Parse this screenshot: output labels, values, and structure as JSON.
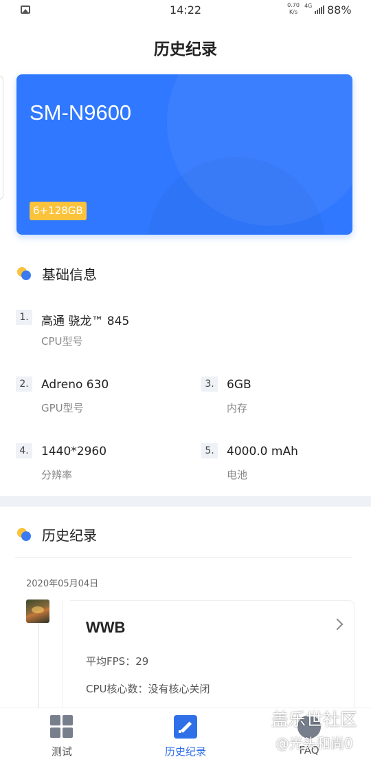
{
  "status_bar": {
    "time": "14:22",
    "net_speed_value": "0.70",
    "net_speed_unit": "K/s",
    "network": "4G",
    "battery": "88%",
    "icons": [
      "gallery-icon",
      "signal-icon"
    ]
  },
  "page_title": "历史纪录",
  "device": {
    "model": "SM-N9600",
    "storage_badge": "6+128GB",
    "card_color": "#2f78ff",
    "badge_color": "#fbc23b"
  },
  "basic_info": {
    "title": "基础信息",
    "items": [
      {
        "num": "1.",
        "value": "高通 骁龙™ 845",
        "caption": "CPU型号"
      },
      {
        "num": "2.",
        "value": "Adreno 630",
        "caption": "GPU型号"
      },
      {
        "num": "3.",
        "value": "6GB",
        "caption": "内存"
      },
      {
        "num": "4.",
        "value": "1440*2960",
        "caption": "分辨率"
      },
      {
        "num": "5.",
        "value": "4000.0 mAh",
        "caption": "电池"
      }
    ]
  },
  "history": {
    "title": "历史纪录",
    "date": "2020年05月04日",
    "records": [
      {
        "game": "WWB",
        "avg_fps": "平均FPS：29",
        "cpu_cores": "CPU核心数：没有核心关闭",
        "partial": "……"
      }
    ]
  },
  "bottom_nav": {
    "items": [
      {
        "label": "测试",
        "icon": "grid-icon"
      },
      {
        "label": "历史纪录",
        "icon": "edit-icon",
        "active": true
      },
      {
        "label": "FAQ",
        "icon": "faq-icon"
      }
    ],
    "accent": "#2f6fe8"
  },
  "watermark": {
    "line1": "盖乐世社区",
    "line2": "@光头和尚0"
  }
}
